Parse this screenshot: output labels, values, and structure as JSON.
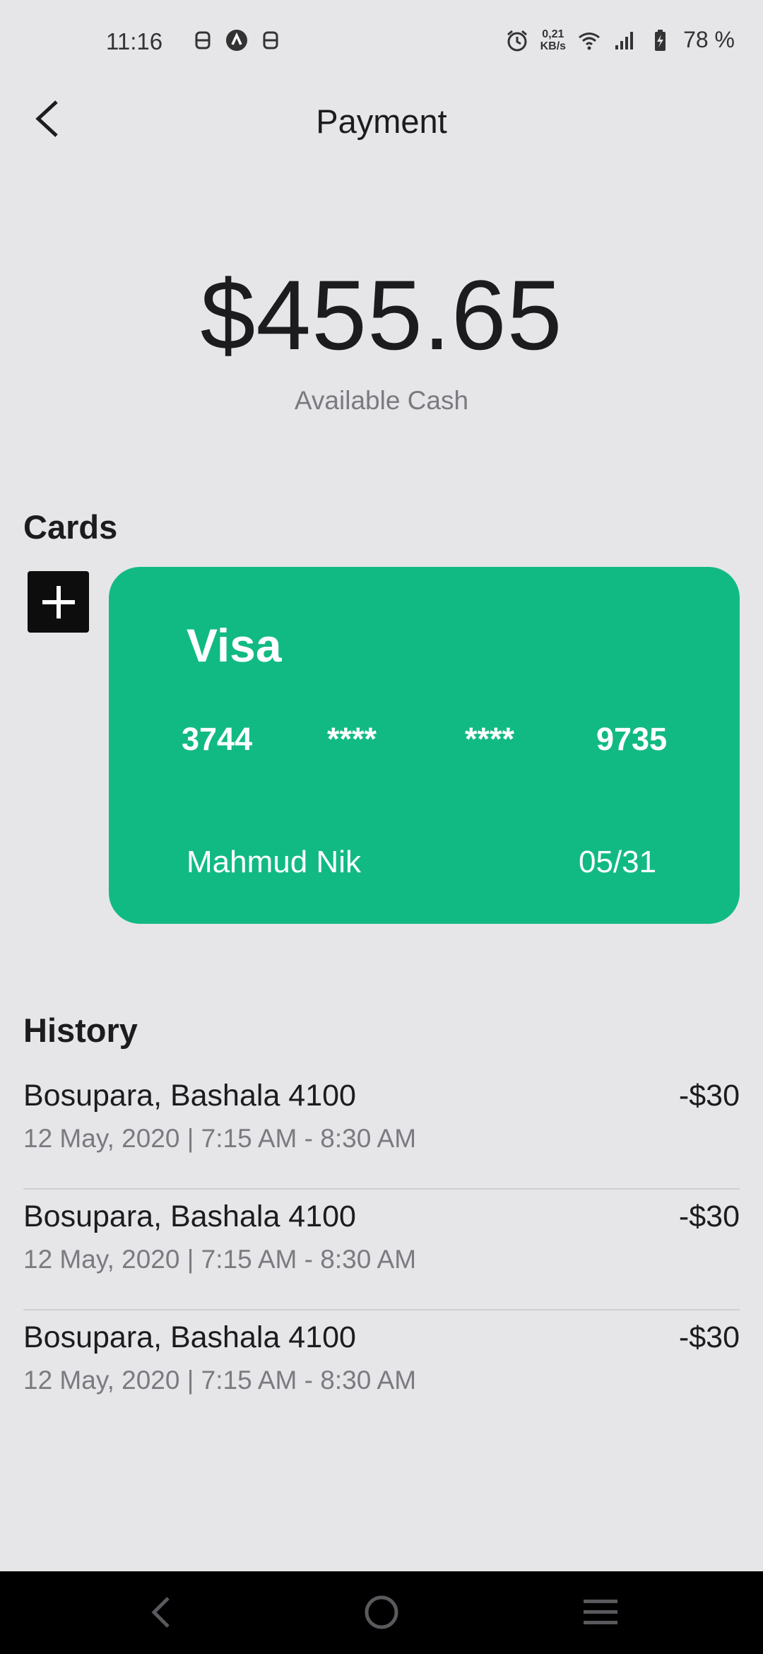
{
  "status_bar": {
    "time": "11:16",
    "net_speed_value": "0,21",
    "net_speed_unit": "KB/s",
    "battery": "78 %",
    "left_icons": [
      "notification-icon",
      "app-a-icon",
      "notification-icon"
    ],
    "right_icons": [
      "alarm-icon",
      "wifi-icon",
      "signal-icon",
      "battery-charging-icon"
    ]
  },
  "header": {
    "title": "Payment",
    "back_icon": "chevron-left-icon"
  },
  "balance": {
    "amount": "$455.65",
    "label": "Available Cash"
  },
  "cards_section": {
    "title": "Cards",
    "add_icon": "plus-icon",
    "card": {
      "brand": "Visa",
      "number_groups": [
        "3744",
        "****",
        "****",
        "9735"
      ],
      "holder": "Mahmud Nik",
      "expiry": "05/31",
      "color": "#12BA83"
    }
  },
  "history_section": {
    "title": "History",
    "items": [
      {
        "place": "Bosupara, Bashala 4100",
        "time": "12 May, 2020 | 7:15 AM - 8:30 AM",
        "amount": "-$30"
      },
      {
        "place": "Bosupara, Bashala 4100",
        "time": "12 May, 2020 | 7:15 AM - 8:30 AM",
        "amount": "-$30"
      },
      {
        "place": "Bosupara, Bashala 4100",
        "time": "12 May, 2020 | 7:15 AM - 8:30 AM",
        "amount": "-$30"
      }
    ]
  },
  "nav_bar": {
    "buttons": [
      "back-icon",
      "home-icon",
      "menu-icon"
    ]
  }
}
